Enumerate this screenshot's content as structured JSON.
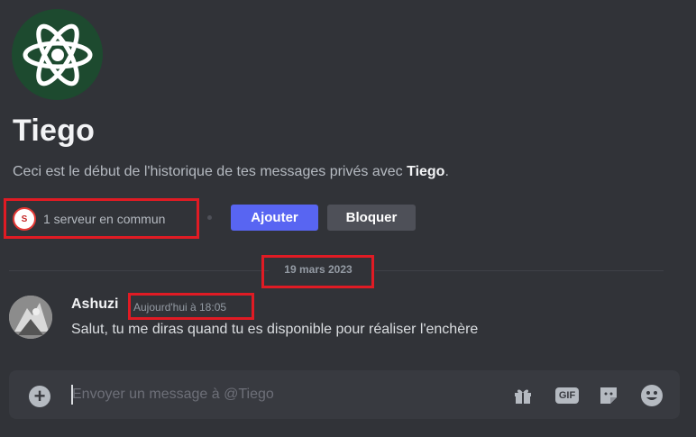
{
  "profile": {
    "name": "Tiego",
    "intro_prefix": "Ceci est le début de l'historique de tes messages privés avec",
    "intro_name": "Tiego",
    "intro_suffix": "."
  },
  "common": {
    "server_icon_text": "S",
    "label": "1 serveur en commun"
  },
  "buttons": {
    "add_label": "Ajouter",
    "block_label": "Bloquer"
  },
  "divider": {
    "date": "19 mars 2023"
  },
  "message": {
    "author": "Ashuzi",
    "timestamp": "Aujourd'hui à 18:05",
    "text": "Salut, tu me diras quand tu es disponible pour réaliser l'enchère"
  },
  "composer": {
    "placeholder": "Envoyer un message à @Tiego",
    "gif_label": "GIF"
  },
  "colors": {
    "accent": "#5865f2",
    "highlight": "#e01b24",
    "background": "#313338"
  }
}
